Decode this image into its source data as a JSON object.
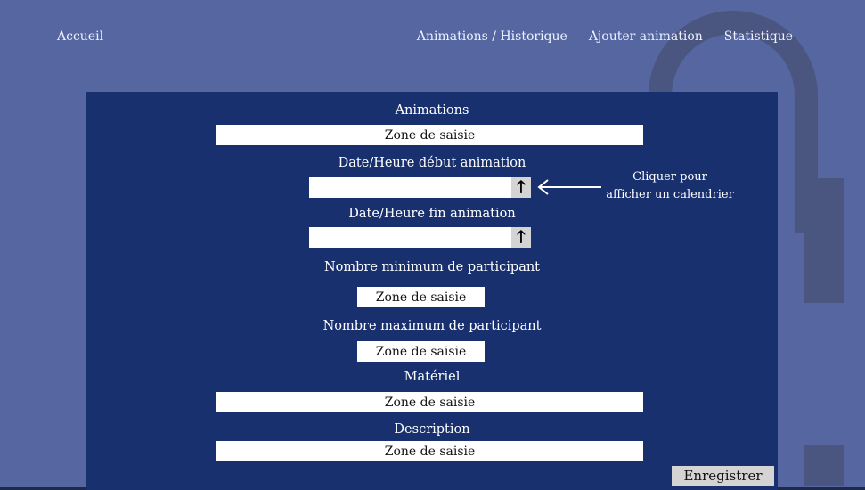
{
  "nav": {
    "home": "Accueil",
    "items": [
      "Animations / Historique",
      "Ajouter animation",
      "Statistique"
    ]
  },
  "form": {
    "animations_label": "Animations",
    "animations_placeholder": "Zone de saisie",
    "start_label": "Date/Heure  début animation",
    "end_label": "Date/Heure  fin  animation",
    "date_button_glyph": "🡑",
    "min_label": "Nombre minimum de participant",
    "min_placeholder": "Zone de saisie",
    "max_label": "Nombre maximum de participant",
    "max_placeholder": "Zone de saisie",
    "materiel_label": "Matériel",
    "materiel_placeholder": "Zone de saisie",
    "description_label": "Description",
    "description_placeholder": "Zone de saisie",
    "save_label": "Enregistrer"
  },
  "annotation": {
    "line1": "Cliquer pour",
    "line2": "afficher un calendrier"
  },
  "colors": {
    "background": "#5566a0",
    "panel": "#19306f",
    "field": "#ffffff",
    "button": "#d4d4d4"
  }
}
